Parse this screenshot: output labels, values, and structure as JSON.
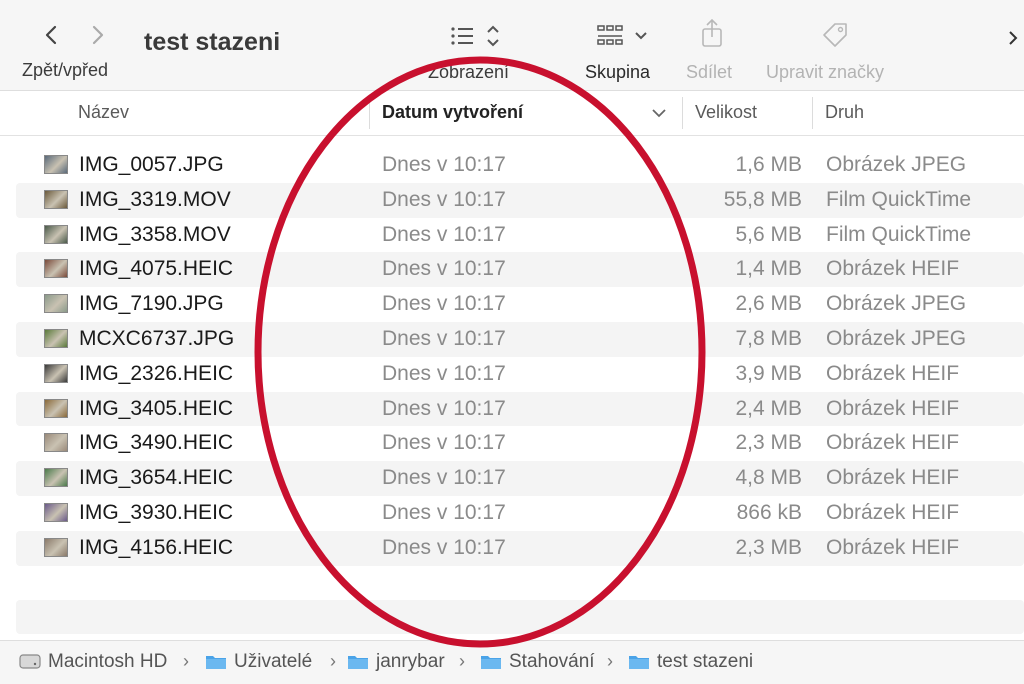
{
  "toolbar": {
    "nav_label": "Zpět/vpřed",
    "title": "test stazeni",
    "view_label": "Zobrazení",
    "group_label": "Skupina",
    "share_label": "Sdílet",
    "tags_label": "Upravit značky"
  },
  "columns": {
    "name": "Název",
    "date": "Datum vytvoření",
    "size": "Velikost",
    "kind": "Druh"
  },
  "files": [
    {
      "name": "IMG_0057.JPG",
      "date": "Dnes v 10:17",
      "size": "1,6 MB",
      "kind": "Obrázek JPEG",
      "thumb_color": "#5a6a7a"
    },
    {
      "name": "IMG_3319.MOV",
      "date": "Dnes v 10:17",
      "size": "55,8 MB",
      "kind": "Film QuickTime",
      "thumb_color": "#6b5a3c"
    },
    {
      "name": "IMG_3358.MOV",
      "date": "Dnes v 10:17",
      "size": "5,6 MB",
      "kind": "Film QuickTime",
      "thumb_color": "#4a5a4a"
    },
    {
      "name": "IMG_4075.HEIC",
      "date": "Dnes v 10:17",
      "size": "1,4 MB",
      "kind": "Obrázek HEIF",
      "thumb_color": "#7a4a3a"
    },
    {
      "name": "IMG_7190.JPG",
      "date": "Dnes v 10:17",
      "size": "2,6 MB",
      "kind": "Obrázek JPEG",
      "thumb_color": "#8a9a8a"
    },
    {
      "name": "MCXC6737.JPG",
      "date": "Dnes v 10:17",
      "size": "7,8 MB",
      "kind": "Obrázek JPEG",
      "thumb_color": "#5a7a3a"
    },
    {
      "name": "IMG_2326.HEIC",
      "date": "Dnes v 10:17",
      "size": "3,9 MB",
      "kind": "Obrázek HEIF",
      "thumb_color": "#3a3a3a"
    },
    {
      "name": "IMG_3405.HEIC",
      "date": "Dnes v 10:17",
      "size": "2,4 MB",
      "kind": "Obrázek HEIF",
      "thumb_color": "#8a6a3a"
    },
    {
      "name": "IMG_3490.HEIC",
      "date": "Dnes v 10:17",
      "size": "2,3 MB",
      "kind": "Obrázek HEIF",
      "thumb_color": "#9a8a7a"
    },
    {
      "name": "IMG_3654.HEIC",
      "date": "Dnes v 10:17",
      "size": "4,8 MB",
      "kind": "Obrázek HEIF",
      "thumb_color": "#4a7a4a"
    },
    {
      "name": "IMG_3930.HEIC",
      "date": "Dnes v 10:17",
      "size": "866 kB",
      "kind": "Obrázek HEIF",
      "thumb_color": "#6a5a8a"
    },
    {
      "name": "IMG_4156.HEIC",
      "date": "Dnes v 10:17",
      "size": "2,3 MB",
      "kind": "Obrázek HEIF",
      "thumb_color": "#8a7a6a"
    }
  ],
  "pathbar": [
    {
      "label": "Macintosh HD",
      "icon": "disk-icon"
    },
    {
      "label": "Uživatelé",
      "icon": "folder-users-icon"
    },
    {
      "label": "janrybar",
      "icon": "home-folder-icon"
    },
    {
      "label": "Stahování",
      "icon": "downloads-folder-icon"
    },
    {
      "label": "test stazeni",
      "icon": "folder-icon"
    }
  ],
  "colors": {
    "accent_folder": "#4aa3e8",
    "annotation": "#c8102e"
  }
}
